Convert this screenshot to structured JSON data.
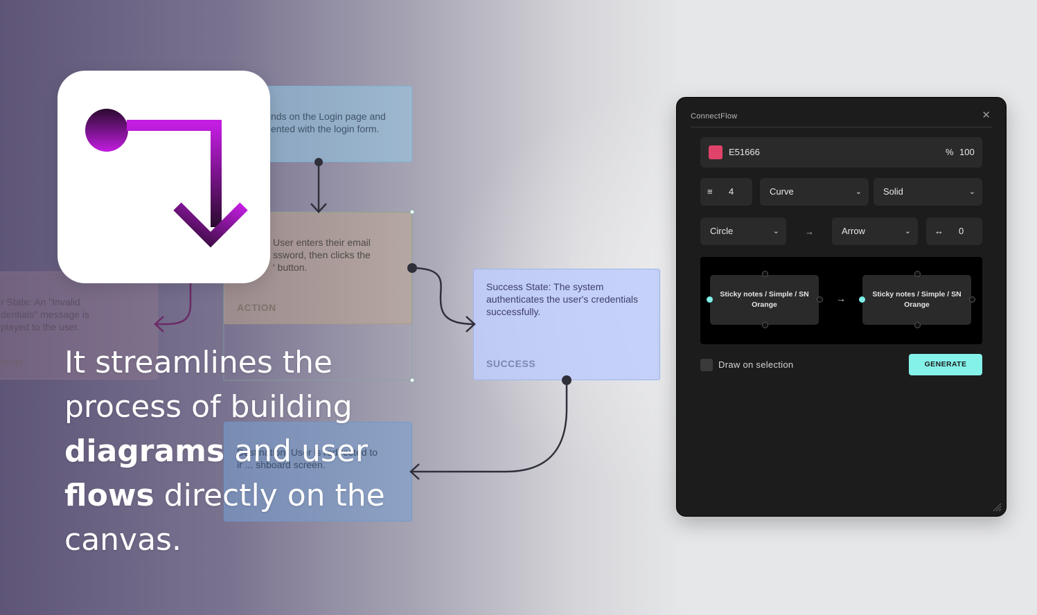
{
  "canvas": {
    "cards": {
      "login": {
        "text": "nds on the Login page and\nented with the login form."
      },
      "action": {
        "text": "User enters their email\nssword, then clicks the\n' button.",
        "tag": "ACTION"
      },
      "error": {
        "text": "r State: An \"Invalid\ndentials\" message is\nplayed to the user.",
        "tag": "ROR"
      },
      "success": {
        "text": "Success State: The system authenticates the user's credentials successfully.",
        "tag": "SUCCESS"
      },
      "destination": {
        "text": "Destination: User is redirected to\nir ... shboard screen."
      }
    }
  },
  "tagline": {
    "part1": "It streamlines the process of building ",
    "bold1": "diagrams",
    "part2": " and user ",
    "bold2": "flows",
    "part3": " directly on the canvas."
  },
  "panel": {
    "title": "ConnectFlow",
    "close_icon": "close-icon",
    "color": {
      "hex_label": "E51666",
      "swatch": "#E0436A",
      "opacity_symbol": "%",
      "opacity": "100"
    },
    "stroke": {
      "icon": "≡",
      "width": "4"
    },
    "path_type": {
      "selected": "Curve"
    },
    "line_style": {
      "selected": "Solid"
    },
    "start_cap": {
      "selected": "Circle"
    },
    "cap_arrow": "→",
    "end_cap": {
      "selected": "Arrow"
    },
    "offset": {
      "icon": "↔",
      "value": "0"
    },
    "preview": {
      "left_node": "Sticky notes / Simple / SN Orange",
      "arrow": "→",
      "right_node": "Sticky notes / Simple / SN Orange"
    },
    "draw_on_selection_label": "Draw on selection",
    "generate_label": "GENERATE"
  },
  "colors": {
    "accent": "#85F2EA",
    "logo_start": "#C21DE0",
    "logo_end": "#2A0A2E"
  }
}
